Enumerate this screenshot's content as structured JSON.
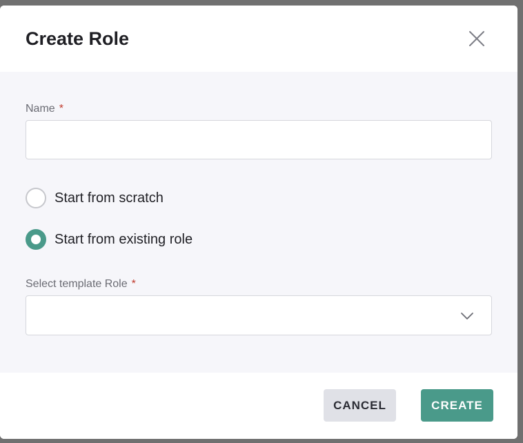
{
  "dialog": {
    "title": "Create Role",
    "close_icon": "close-icon"
  },
  "form": {
    "name": {
      "label": "Name",
      "required_marker": "*",
      "value": "",
      "placeholder": ""
    },
    "start_options": [
      {
        "label": "Start from scratch",
        "checked": false
      },
      {
        "label": "Start from existing role",
        "checked": true
      }
    ],
    "template_role": {
      "label": "Select template Role",
      "required_marker": "*",
      "selected_value": "",
      "icon": "chevron-down-icon"
    }
  },
  "footer": {
    "cancel_label": "CANCEL",
    "create_label": "CREATE"
  },
  "colors": {
    "accent": "#4a9a8a",
    "required": "#c0392b",
    "body_bg": "#f6f6fa",
    "cancel_bg": "#e0e1e7"
  }
}
